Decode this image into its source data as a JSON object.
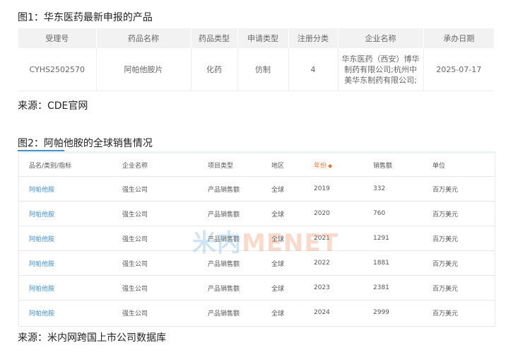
{
  "figure1": {
    "caption": "图1：华东医药最新申报的产品",
    "headers": [
      "受理号",
      "药品名称",
      "药品类型",
      "申请类型",
      "注册分类",
      "企业名称",
      "承办日期"
    ],
    "row": [
      "CYHS2502570",
      "阿帕他胺片",
      "化药",
      "仿制",
      "4",
      "华东医药（西安）博华制药有限公司;杭州中美华东制药有限公司;",
      "2025-07-17"
    ],
    "source": "来源：CDE官网"
  },
  "figure2": {
    "caption": "图2：阿帕他胺的全球销售情况",
    "headers": [
      "品名/类别/指标",
      "企业名称",
      "项目类型",
      "地区",
      "年份",
      "销售额",
      "单位"
    ],
    "sort_symbol": "◆",
    "rows": [
      [
        "阿帕他胺",
        "强生公司",
        "产品销售额",
        "全球",
        "2019",
        "332",
        "百万美元"
      ],
      [
        "阿帕他胺",
        "强生公司",
        "产品销售额",
        "全球",
        "2020",
        "760",
        "百万美元"
      ],
      [
        "阿帕他胺",
        "强生公司",
        "产品销售额",
        "全球",
        "2021",
        "1291",
        "百万美元"
      ],
      [
        "阿帕他胺",
        "强生公司",
        "产品销售额",
        "全球",
        "2022",
        "1881",
        "百万美元"
      ],
      [
        "阿帕他胺",
        "强生公司",
        "产品销售额",
        "全球",
        "2023",
        "2381",
        "百万美元"
      ],
      [
        "阿帕他胺",
        "强生公司",
        "产品销售额",
        "全球",
        "2024",
        "2999",
        "百万美元"
      ]
    ],
    "watermark_a": "米内",
    "watermark_b": "MENET",
    "source": "来源：米内网跨国上市公司数据库"
  },
  "colors": {
    "link": "#4a90c8",
    "sorted_header": "#e8763a",
    "header_bg": "#f2f2f2"
  }
}
